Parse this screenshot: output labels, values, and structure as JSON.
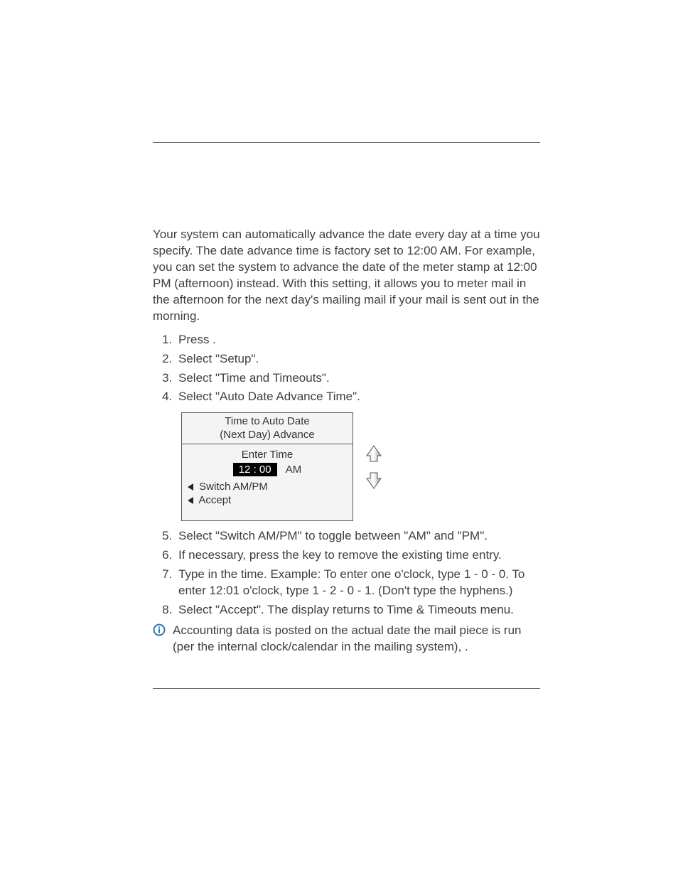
{
  "intro": "Your system can automatically advance the date every day at a time you specify. The date advance time is factory set to 12:00 AM. For example, you can set the system to advance the date of the meter stamp at 12:00 PM (afternoon) instead. With this setting, it allows you to meter mail in the afternoon for the next day's mailing mail if your mail is sent out in the morning.",
  "steps_a": {
    "1": "Press           .",
    "2": "Select \"Setup\".",
    "3": "Select \"Time and Timeouts\".",
    "4": "Select \"Auto Date Advance Time\"."
  },
  "screen": {
    "title_line1": "Time to Auto Date",
    "title_line2": "(Next Day) Advance",
    "enter_label": "Enter Time",
    "time_value": "12 : 00",
    "ampm": "AM",
    "opt_switch": "Switch AM/PM",
    "opt_accept": "Accept"
  },
  "steps_b": {
    "5": "Select \"Switch AM/PM\" to toggle between \"AM\" and \"PM\".",
    "6": "If necessary, press the           key to remove the existing time entry.",
    "7": "Type in the time. Example: To enter one o'clock, type 1 - 0 - 0. To enter 12:01 o'clock, type 1 - 2 - 0 - 1. (Don't type the hyphens.)",
    "8": "Select \"Accept\". The display returns to Time & Timeouts menu."
  },
  "note": "            Accounting data is posted on the actual date the mail piece is run (per the internal clock/calendar in the mailing system),                                                                      ."
}
